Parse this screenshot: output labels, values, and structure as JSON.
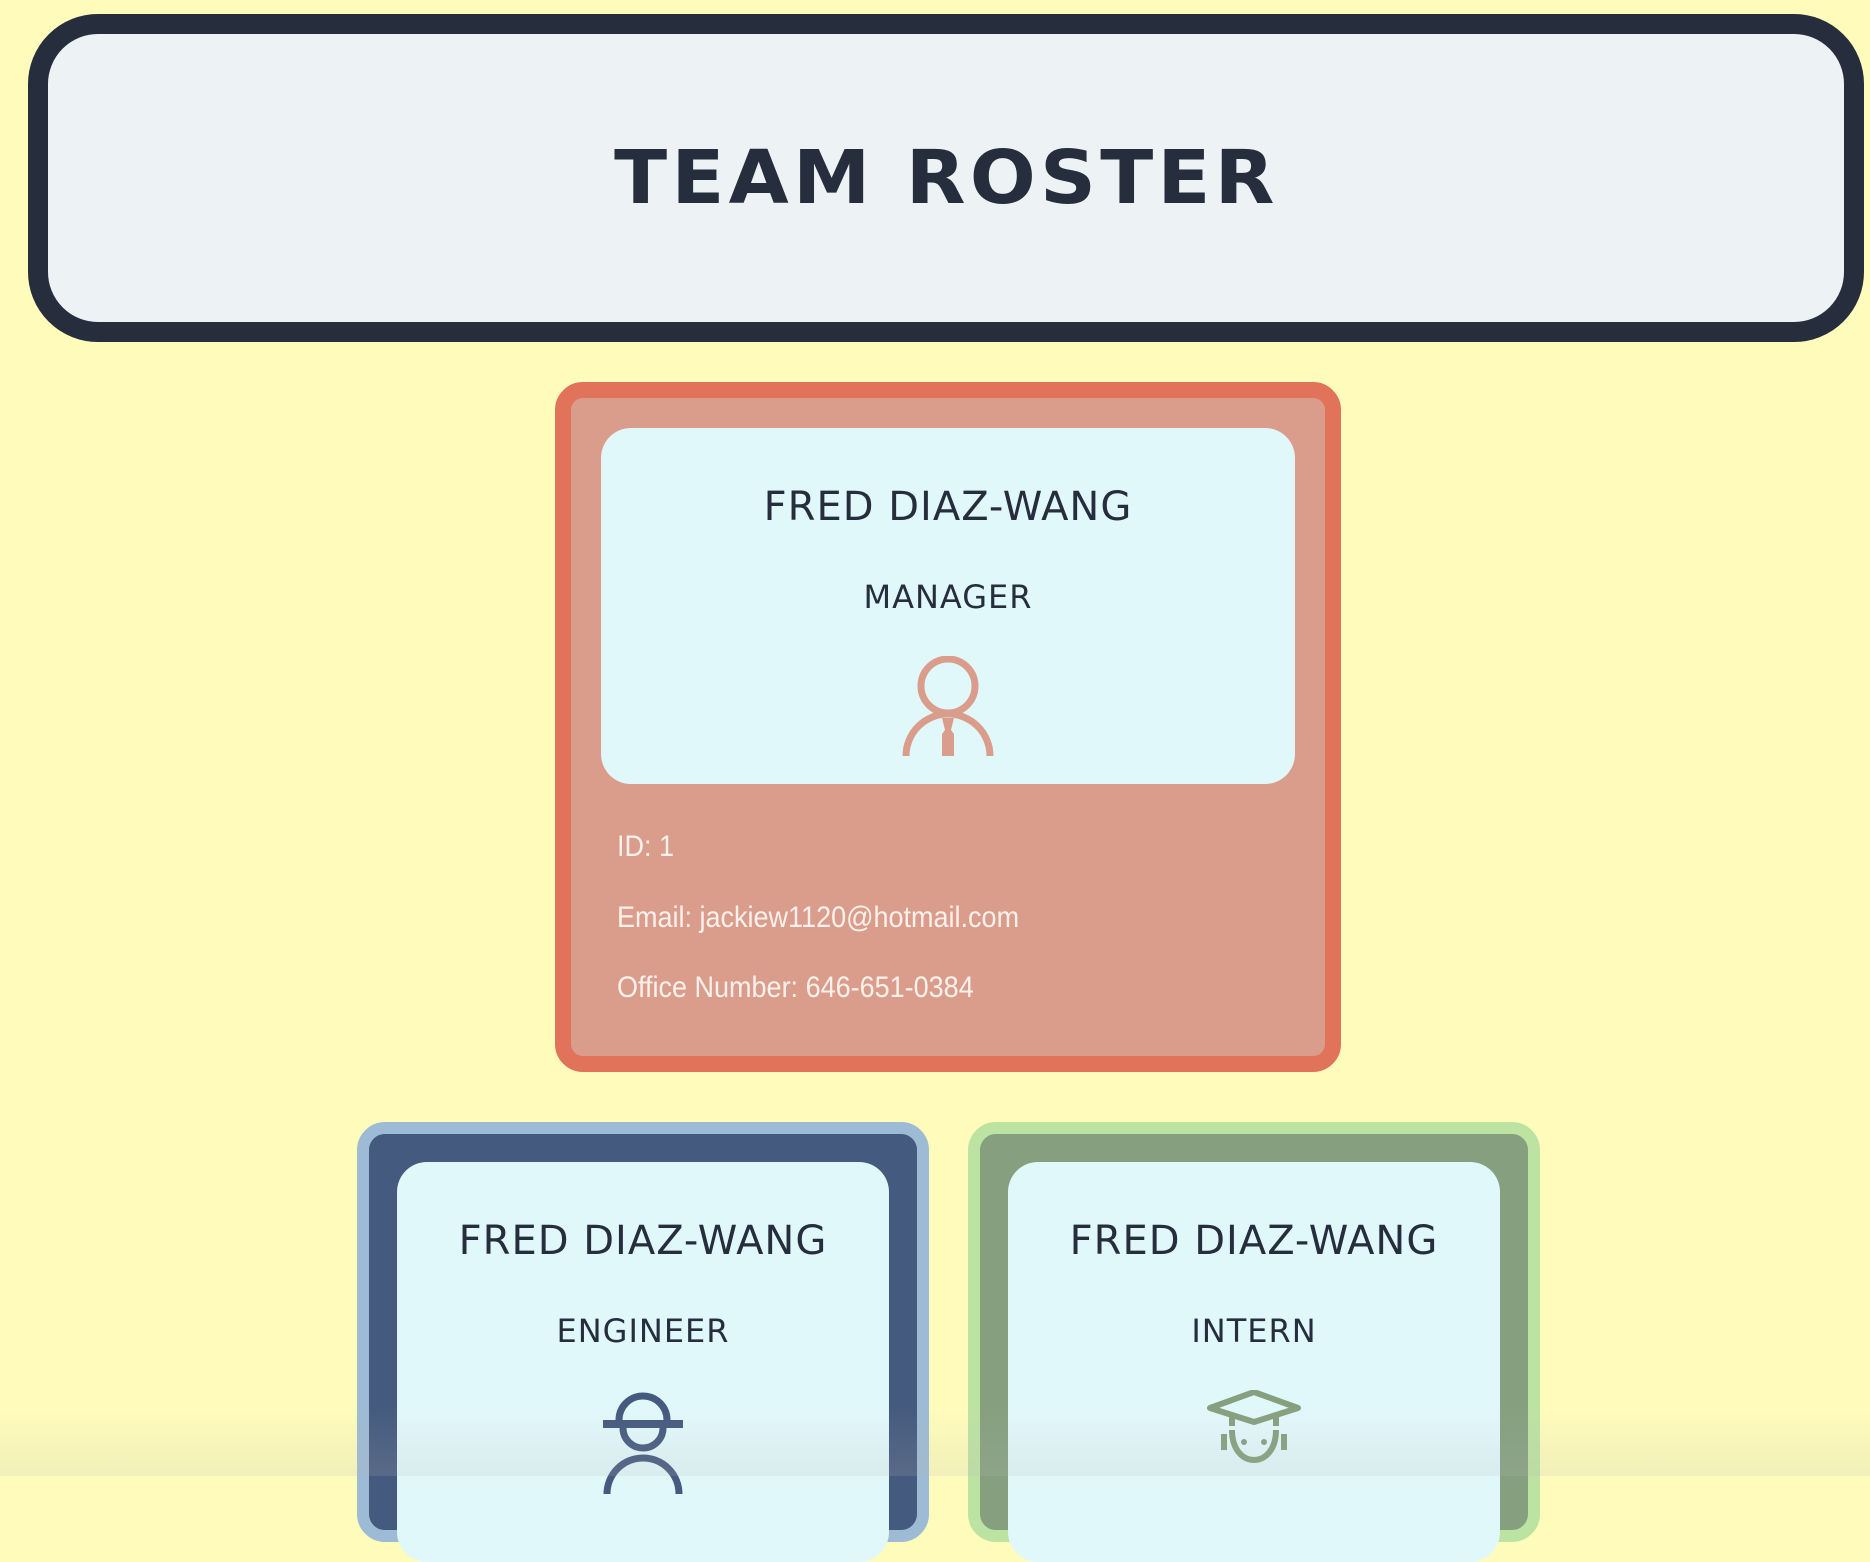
{
  "header": {
    "title": "TEAM ROSTER"
  },
  "colors": {
    "background": "#fffcbb",
    "header_border": "#262d3d",
    "manager_border": "#e0735a",
    "manager_fill": "#da9d8c",
    "engineer_border": "#9ebbd5",
    "engineer_fill": "#445a7e",
    "intern_border": "#bde3a2",
    "intern_fill": "#86a07f",
    "card_top": "#e1f8fb"
  },
  "cards": [
    {
      "name": "FRED DIAZ-WANG",
      "role": "MANAGER",
      "icon": "manager-person-icon",
      "id_text": "ID: 1",
      "email_text": "Email: jackiew1120@hotmail.com",
      "extra_text": "Office Number: 646-651-0384"
    },
    {
      "name": "FRED DIAZ-WANG",
      "role": "ENGINEER",
      "icon": "engineer-hardhat-icon"
    },
    {
      "name": "FRED DIAZ-WANG",
      "role": "INTERN",
      "icon": "intern-graduate-icon"
    }
  ]
}
